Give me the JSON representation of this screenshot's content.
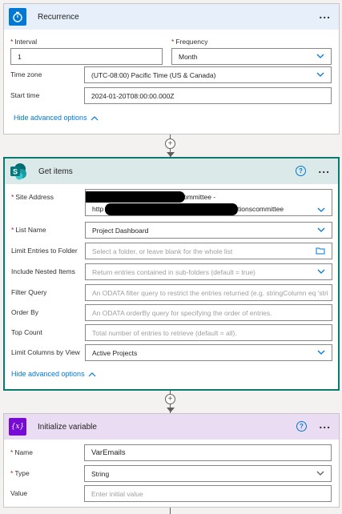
{
  "recurrence": {
    "title": "Recurrence",
    "more": "...",
    "interval_label": "Interval",
    "interval_value": "1",
    "frequency_label": "Frequency",
    "frequency_value": "Month",
    "timezone_label": "Time zone",
    "timezone_value": "(UTC-08:00) Pacific Time (US & Canada)",
    "start_label": "Start time",
    "start_value": "2024-01-20T08:00:00.000Z",
    "advanced_link": "Hide advanced options",
    "icon": "clock-icon",
    "header_color": "#0078d4"
  },
  "get_items": {
    "title": "Get items",
    "help": "?",
    "more": "...",
    "site_label": "Site Address",
    "site_line1_tail": "ommittee -",
    "site_line2_head": "http",
    "site_line2_tail": "tionscommittee",
    "list_label": "List Name",
    "list_value": "Project Dashboard",
    "folder_label": "Limit Entries to Folder",
    "folder_placeholder": "Select a folder, or leave blank for the whole list",
    "nested_label": "Include Nested Items",
    "nested_placeholder": "Return entries contained in sub-folders (default = true)",
    "filter_label": "Filter Query",
    "filter_placeholder": "An ODATA filter query to restrict the entries returned (e.g. stringColumn eq 'stri",
    "order_label": "Order By",
    "order_placeholder": "An ODATA orderBy query for specifying the order of entries.",
    "top_label": "Top Count",
    "top_placeholder": "Total number of entries to retrieve (default = all).",
    "columns_label": "Limit Columns by View",
    "columns_value": "Active Projects",
    "advanced_link": "Hide advanced options",
    "icon": "sharepoint-icon",
    "header_color": "#036c70"
  },
  "init_var": {
    "title": "Initialize variable",
    "help": "?",
    "more": "...",
    "name_label": "Name",
    "name_value": "VarEmails",
    "type_label": "Type",
    "type_value": "String",
    "value_label": "Value",
    "value_placeholder": "Enter initial value",
    "icon_text": "{x}",
    "header_color": "#770bd6"
  },
  "connectors": {
    "plus": "+"
  }
}
